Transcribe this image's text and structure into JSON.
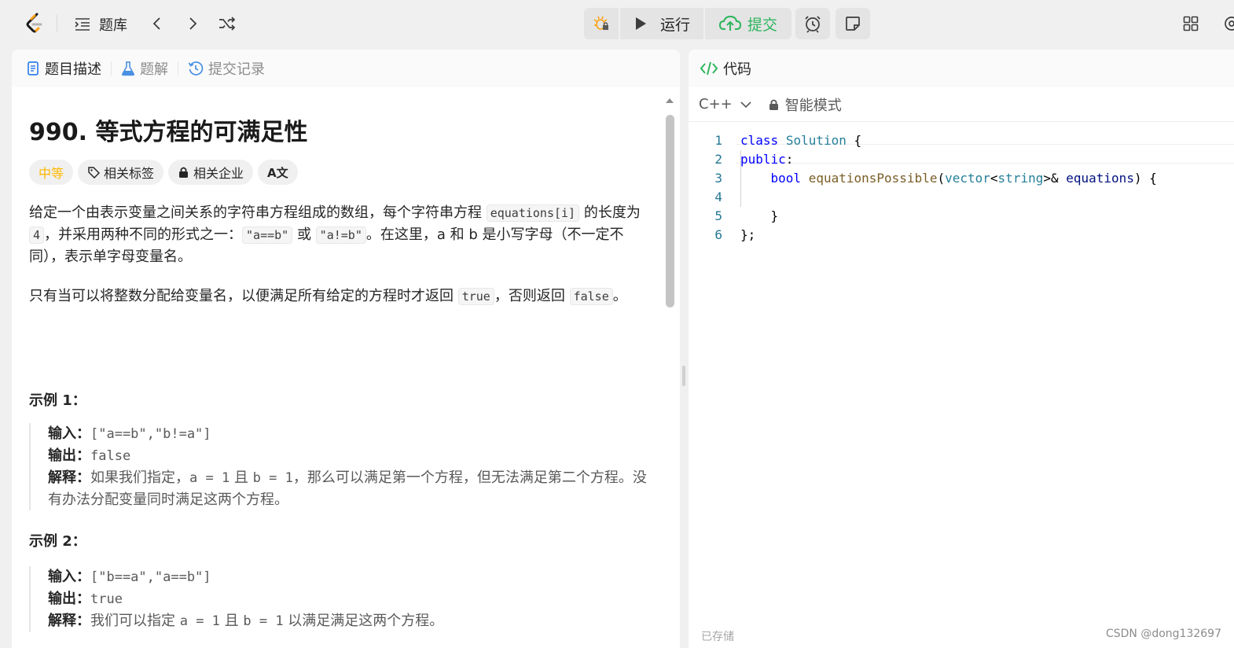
{
  "topbar": {
    "problem_bank_label": "题库",
    "run_label": "运行",
    "submit_label": "提交",
    "icons": [
      "logo-icon",
      "list-icon",
      "chevron-left-icon",
      "chevron-right-icon",
      "shuffle-icon",
      "debug-icon",
      "play-icon",
      "cloud-upload-icon",
      "alarm-icon",
      "note-icon",
      "layout-icon",
      "gear-icon"
    ]
  },
  "left": {
    "tabs": [
      "题目描述",
      "题解",
      "提交记录"
    ],
    "title": "990. 等式方程的可满足性",
    "badges": {
      "difficulty": "中等",
      "tags": "相关标签",
      "companies": "相关企业",
      "translate": "A文"
    },
    "desc1": {
      "t1": "给定一个由表示变量之间关系的字符串方程组成的数组，每个字符串方程 ",
      "c1": "equations[i]",
      "t2": " 的长度为 ",
      "c2": "4",
      "t3": "，并采用两种不同的形式之一：",
      "c3": "\"a==b\"",
      "t4": " 或 ",
      "c4": "\"a!=b\"",
      "t5": "。在这里，a 和 b 是小写字母（不一定不同），表示单字母变量名。"
    },
    "desc2": {
      "t1": "只有当可以将整数分配给变量名，以便满足所有给定的方程时才返回 ",
      "c1": "true",
      "t2": "，否则返回 ",
      "c2": "false",
      "t3": "。"
    },
    "examples": [
      {
        "title": "示例 1：",
        "input_label": "输入：",
        "input": "[\"a==b\",\"b!=a\"]",
        "output_label": "输出：",
        "output": "false",
        "explain_label": "解释：",
        "explain_a": "如果我们指定，",
        "explain_code1": "a = 1",
        "explain_b": " 且 ",
        "explain_code2": "b = 1",
        "explain_c": "，那么可以满足第一个方程，但无法满足第二个方程。没有办法分配变量同时满足这两个方程。"
      },
      {
        "title": "示例 2：",
        "input_label": "输入：",
        "input": "[\"b==a\",\"a==b\"]",
        "output_label": "输出：",
        "output": "true",
        "explain_label": "解释：",
        "explain_a": "我们可以指定 ",
        "explain_code1": "a = 1",
        "explain_b": " 且 ",
        "explain_code2": "b = 1",
        "explain_c": " 以满足满足这两个方程。"
      }
    ]
  },
  "right": {
    "header": "代码",
    "language": "C++",
    "mode": "智能模式",
    "code_lines": [
      {
        "n": "1",
        "t": "class Solution {"
      },
      {
        "n": "2",
        "t": "public:"
      },
      {
        "n": "3",
        "t": "    bool equationsPossible(vector<string>& equations) {"
      },
      {
        "n": "4",
        "t": ""
      },
      {
        "n": "5",
        "t": "    }"
      },
      {
        "n": "6",
        "t": "};"
      }
    ],
    "saved": "已存储"
  },
  "watermark": "CSDN @dong132697",
  "colors": {
    "accent_green": "#2db55d",
    "difficulty": "#ffb800",
    "code_blue": "#0000ff",
    "type_teal": "#267f99",
    "func_brown": "#795e26"
  }
}
